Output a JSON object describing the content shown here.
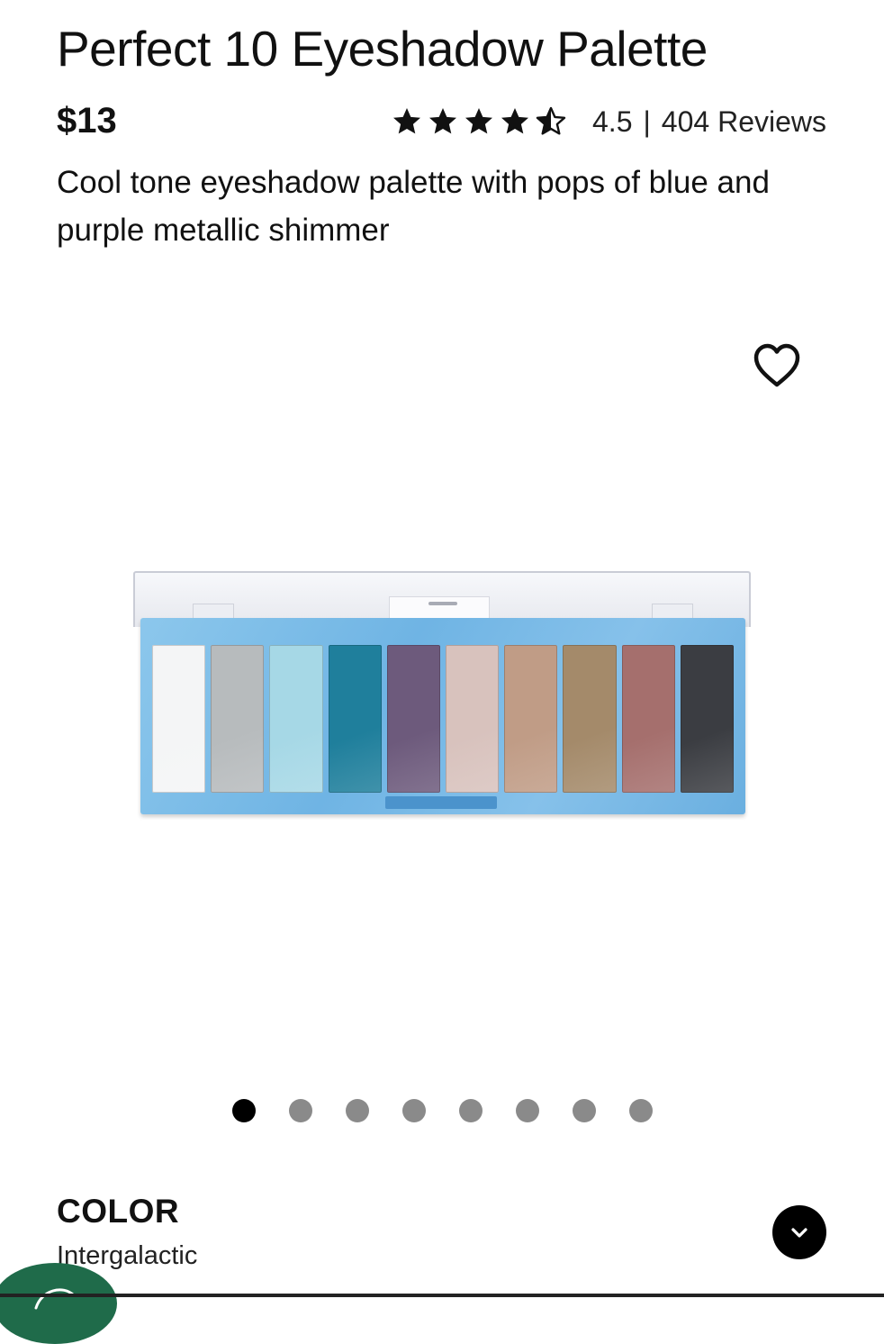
{
  "product": {
    "title": "Perfect 10 Eyeshadow Palette",
    "price": "$13",
    "rating": "4.5",
    "rating_separator": "|",
    "reviews": "404 Reviews",
    "stars": 4.5,
    "description": "Cool tone eyeshadow palette with pops of blue and purple metallic shimmer"
  },
  "icons": {
    "favorite": "heart-outline-icon",
    "expand": "chevron-down-icon",
    "chat": "chat-icon"
  },
  "gallery": {
    "image_count": 8,
    "active_index": 0
  },
  "palette_shades": [
    "#f4f5f6",
    "#b7bbbd",
    "#a6d8e6",
    "#1f7f9c",
    "#6d5a7c",
    "#d8c2bd",
    "#c09c86",
    "#a48a6a",
    "#a56f6d",
    "#3b3d42"
  ],
  "color": {
    "label": "COLOR",
    "value": "Intergalactic"
  },
  "colors": {
    "text": "#111111",
    "palette_case": "#7bbbe7",
    "chat_button": "#1f6b4a",
    "dot_active": "#000000",
    "dot_inactive": "#8a8a8a"
  }
}
